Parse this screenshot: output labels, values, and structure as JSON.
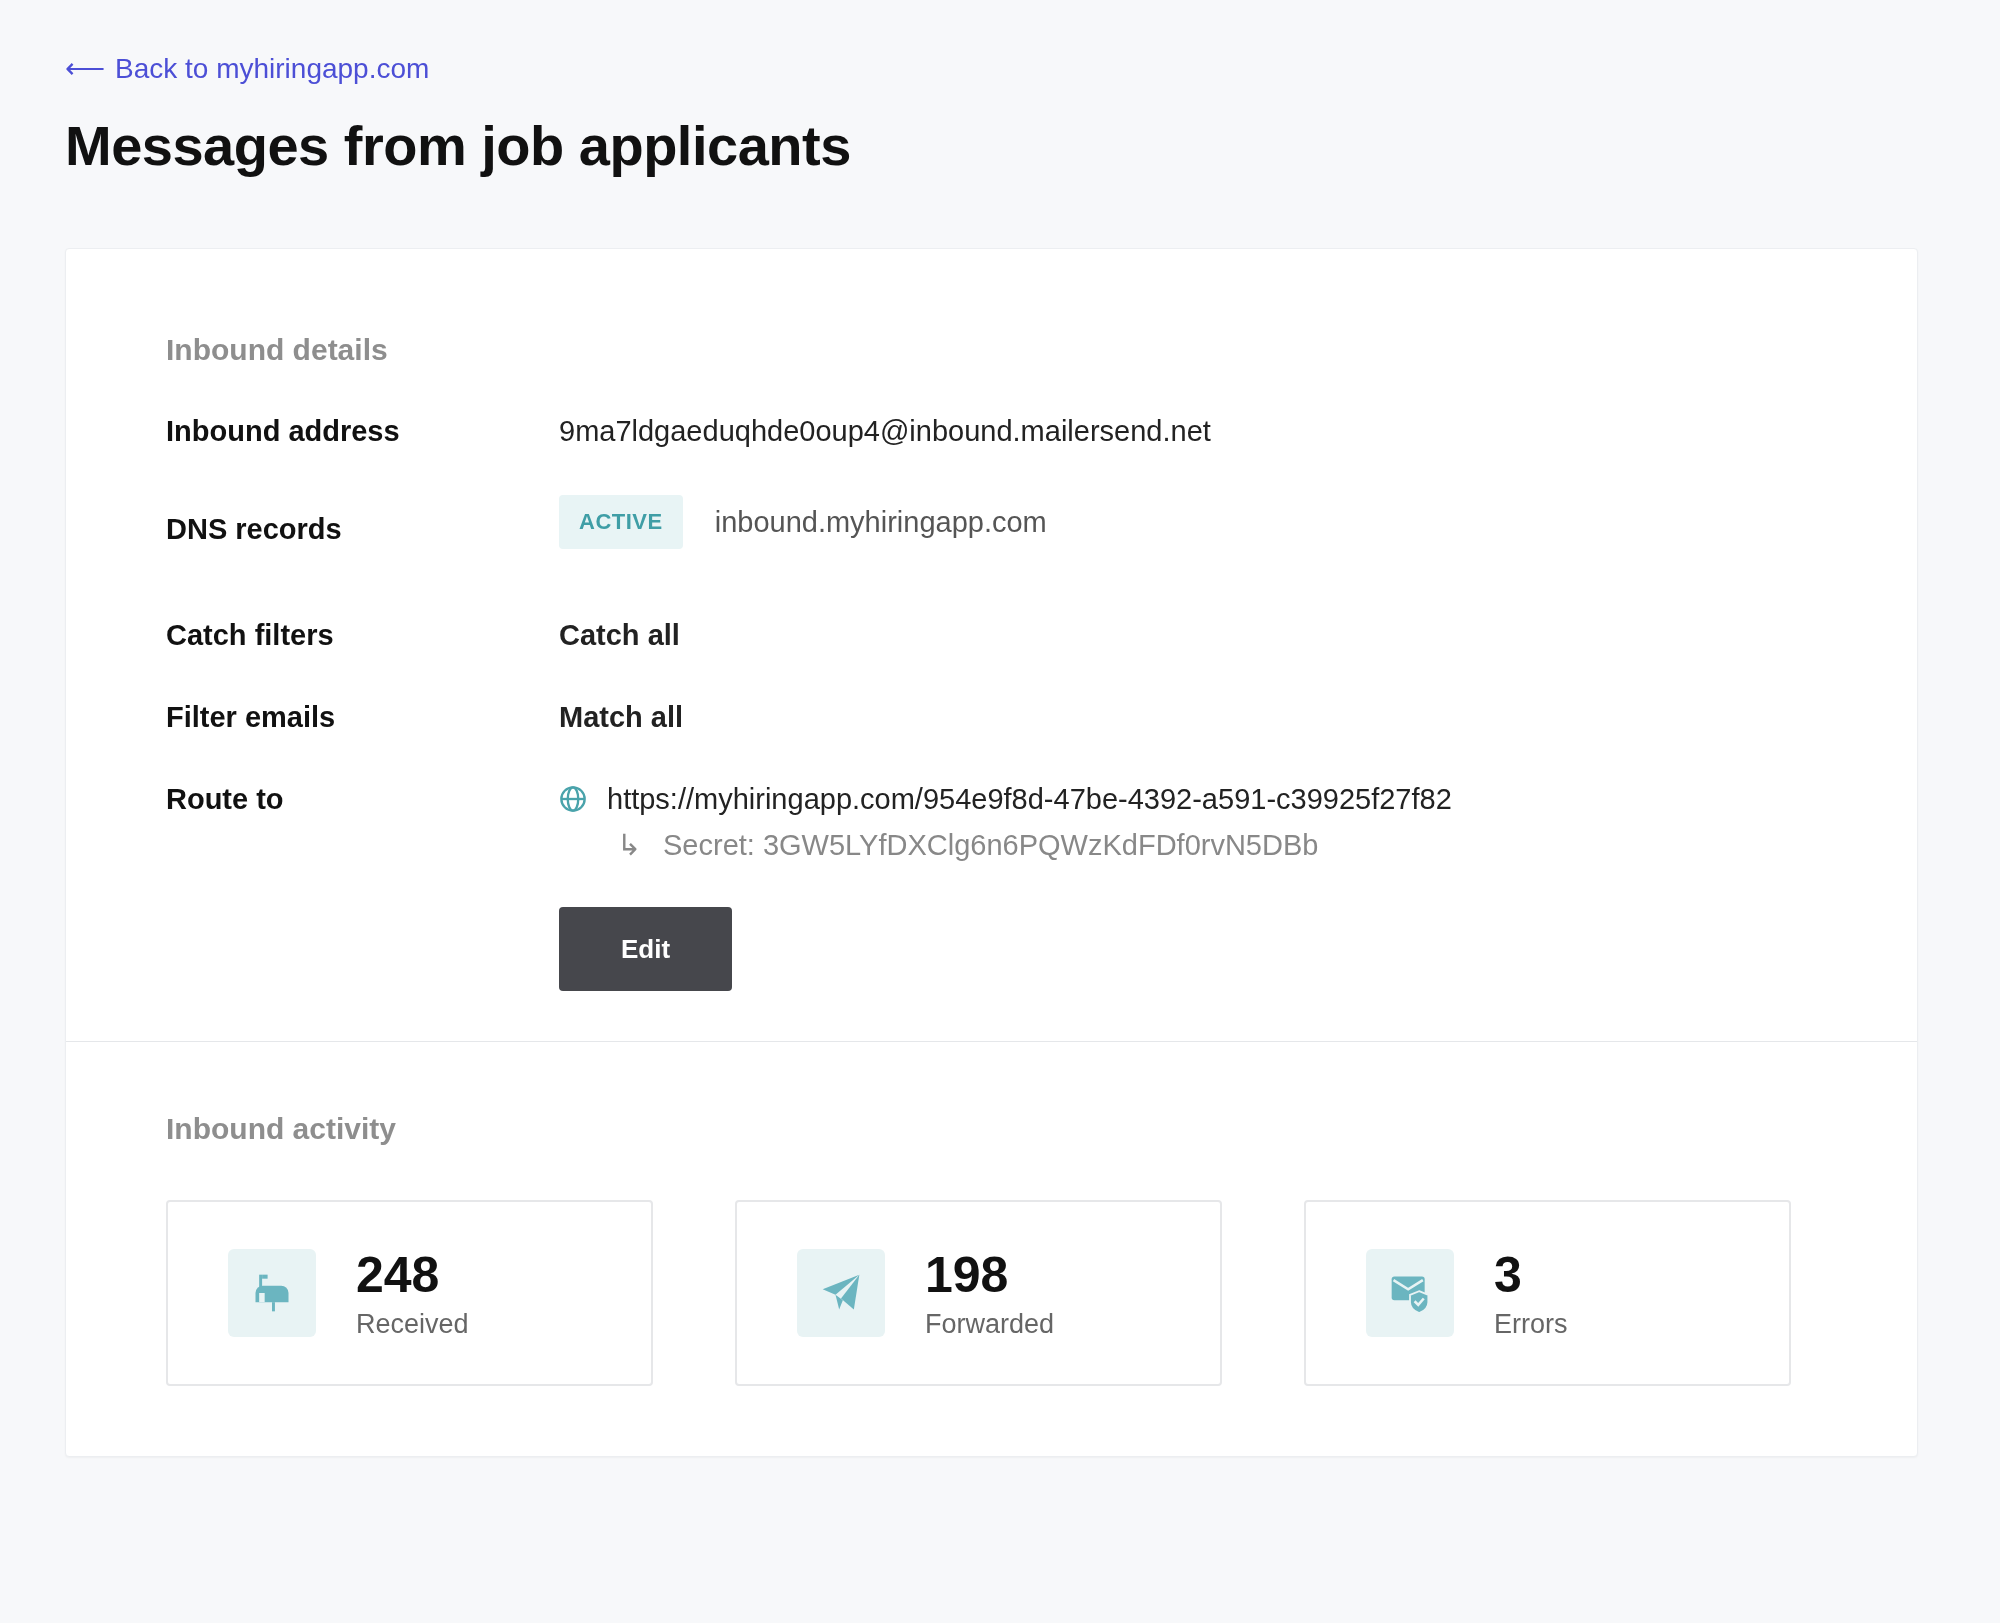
{
  "back_link": {
    "arrow": "⟵",
    "label": "Back to myhiringapp.com"
  },
  "title": "Messages from job applicants",
  "details": {
    "heading": "Inbound details",
    "rows": [
      {
        "label": "Inbound address",
        "kind": "text",
        "value": "9ma7ldgaeduqhde0oup4@inbound.mailersend.net"
      },
      {
        "label": "DNS records",
        "kind": "badge",
        "badge": "ACTIVE",
        "value": "inbound.myhiringapp.com"
      },
      {
        "label": "Catch filters",
        "kind": "bold",
        "value": "Catch all"
      },
      {
        "label": "Filter emails",
        "kind": "bold",
        "value": "Match all"
      },
      {
        "label": "Route to",
        "kind": "url",
        "value": "https://myhiringapp.com/954e9f8d-47be-4392-a591-c39925f27f82",
        "secret_arrow": "↳",
        "secret": "Secret: 3GW5LYfDXClg6n6PQWzKdFDf0rvN5DBb"
      }
    ],
    "button": "Edit"
  },
  "activity": {
    "heading": "Inbound activity",
    "stats": [
      {
        "kind": "received",
        "value": "248",
        "label": "Received"
      },
      {
        "kind": "forwarded",
        "value": "198",
        "label": "Forwarded"
      },
      {
        "kind": "errors",
        "value": "3",
        "label": "Errors"
      }
    ]
  }
}
